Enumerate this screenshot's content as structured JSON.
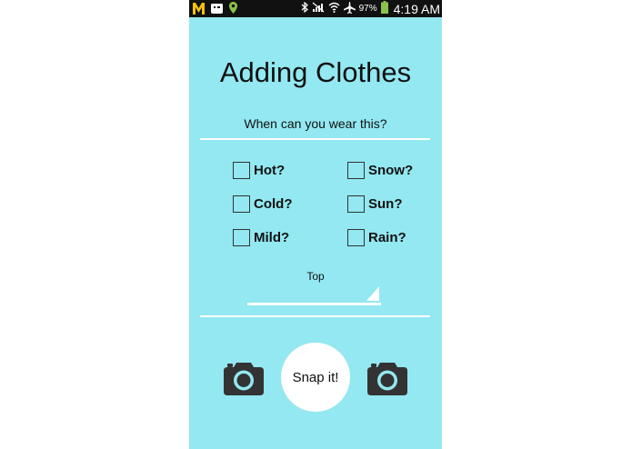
{
  "statusbar": {
    "battery_pct": "97%",
    "time": "4:19 AM"
  },
  "screen": {
    "title": "Adding Clothes",
    "question": "When can you wear this?"
  },
  "conditions": [
    {
      "label": "Hot?"
    },
    {
      "label": "Snow?"
    },
    {
      "label": "Cold?"
    },
    {
      "label": "Sun?"
    },
    {
      "label": "Mild?"
    },
    {
      "label": "Rain?"
    }
  ],
  "category": {
    "selected": "Top"
  },
  "actions": {
    "snap_label": "Snap it!"
  },
  "colors": {
    "background": "#93e8f1",
    "statusbar": "#111111",
    "camera": "#333333",
    "button": "#ffffff"
  }
}
